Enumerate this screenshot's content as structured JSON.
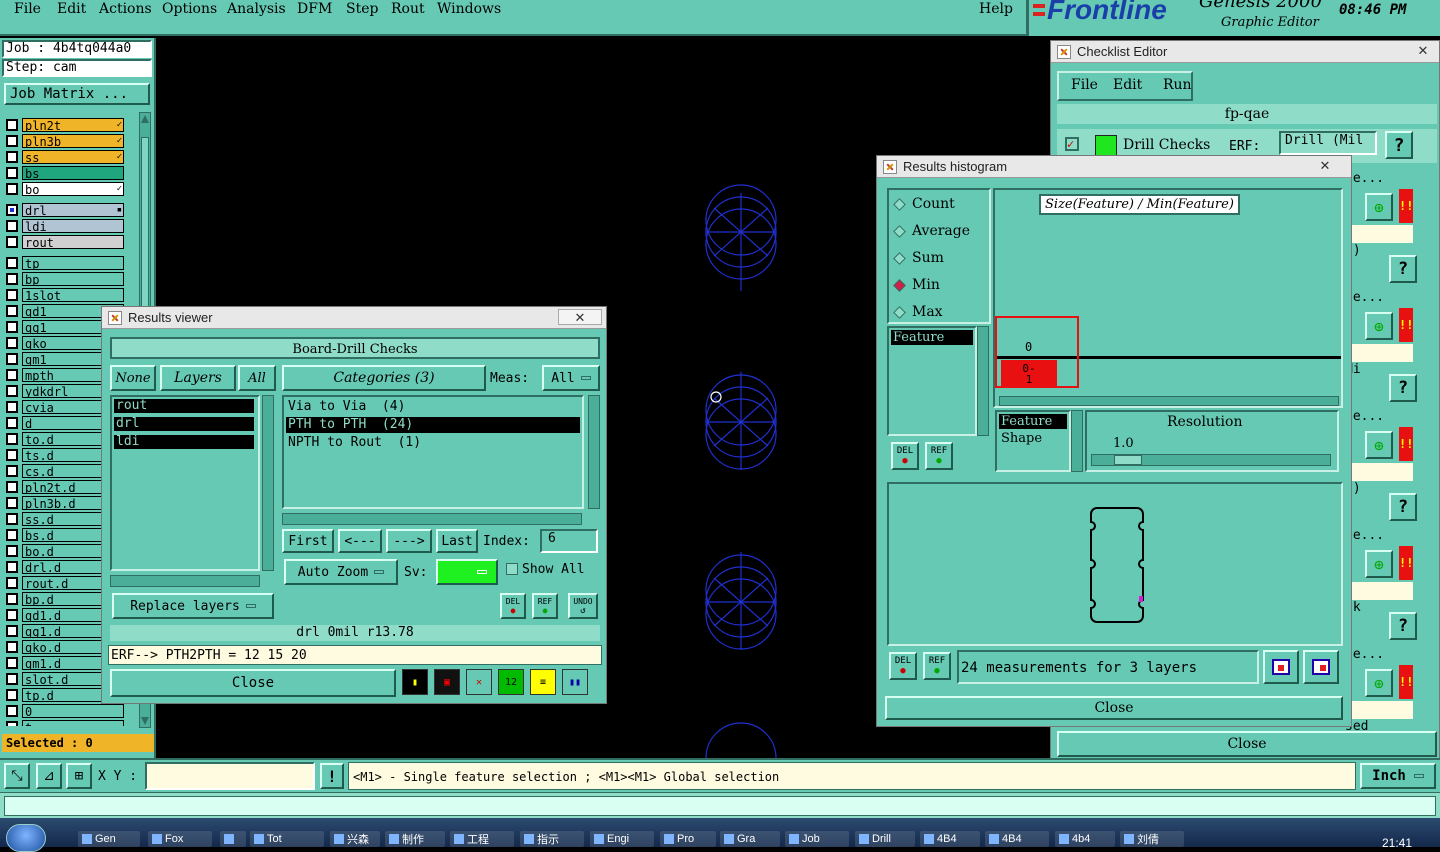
{
  "menubar": {
    "items": [
      "File",
      "Edit",
      "Actions",
      "Options",
      "Analysis",
      "DFM",
      "Step",
      "Rout",
      "Windows"
    ],
    "help": "Help",
    "brand": "Frontline",
    "product": "Genesis 2000",
    "subtitle": "Graphic Editor",
    "clock": "08:46 PM"
  },
  "left_panel": {
    "job": "Job : 4b4tq044a0",
    "step": "Step: cam",
    "job_matrix": "Job Matrix ...",
    "layers_top": [
      {
        "name": "pln2t",
        "color": "#f0b429",
        "mark": "✓"
      },
      {
        "name": "pln3b",
        "color": "#f0b429",
        "mark": "✓"
      },
      {
        "name": "ss",
        "color": "#f0b429",
        "mark": "✓"
      },
      {
        "name": "bs",
        "color": "#1fa67f",
        "mark": ""
      },
      {
        "name": "bo",
        "color": "#ffffff",
        "mark": "✓"
      }
    ],
    "layers_drill": [
      {
        "name": "drl",
        "color": "#b0c4d4",
        "mark": "▪"
      },
      {
        "name": "ldi",
        "color": "#b0c4d4",
        "mark": ""
      },
      {
        "name": "rout",
        "color": "#d0d0d0",
        "mark": ""
      }
    ],
    "layers_misc": [
      "tp",
      "bp",
      "1slot",
      "gd1",
      "gg1",
      "gko",
      "gm1",
      "mpth",
      "ydkdrl",
      "cvia",
      "d",
      "to.d",
      "ts.d",
      "cs.d",
      "pln2t.d",
      "pln3b.d",
      "ss.d",
      "bs.d",
      "bo.d",
      "drl.d",
      "rout.d",
      "bp.d",
      "gd1.d",
      "gg1.d",
      "gko.d",
      "gm1.d",
      "slot.d",
      "tp.d",
      "0",
      "t"
    ],
    "selected": "Selected : 0"
  },
  "statusbar": {
    "xy_label": "X Y :",
    "xy_value": "",
    "warn": "!",
    "message": "<M1> - Single feature selection ; <M1><M1> Global selection",
    "units": "Inch"
  },
  "results_viewer": {
    "title": "Results viewer",
    "close_x": "✕",
    "header": "Board-Drill Checks",
    "none_btn": "None",
    "layers_btn": "Layers",
    "all_btn": "All",
    "categories_btn": "Categories (3)",
    "meas_label": "Meas:",
    "meas_value": "All",
    "layers": [
      "rout",
      "drl",
      "ldi"
    ],
    "categories": [
      "Via to Via  (4)",
      "PTH to PTH  (24)",
      "NPTH to Rout  (1)"
    ],
    "selected_category": 1,
    "first": "First",
    "prev": "<---",
    "next": "--->",
    "last": "Last",
    "index_label": "Index:",
    "index_value": "6",
    "replace_layers": "Replace layers",
    "auto_zoom": "Auto Zoom",
    "sv_label": "Sv:",
    "show_all": "Show All",
    "del": "DEL",
    "ref": "REF",
    "undo": "UNDO",
    "info": "drl 0mil  r13.78",
    "erf_line": "ERF--> PTH2PTH = 12 15 20",
    "close": "Close"
  },
  "histogram": {
    "title": "Results histogram",
    "options": [
      "Count",
      "Average",
      "Sum",
      "Min",
      "Max"
    ],
    "selected_option": 3,
    "heading": "Size(Feature) / Min(Feature)",
    "feature_list": [
      "Feature"
    ],
    "bar_value": "0",
    "bar_label": "0-\n1",
    "group_list": [
      "Feature",
      "Shape"
    ],
    "resolution_label": "Resolution",
    "resolution_value": "1.0",
    "del": "DEL",
    "ref": "REF",
    "measurements": "24 measurements for 3 layers",
    "close": "Close"
  },
  "checklist": {
    "title": "Checklist Editor",
    "menu": [
      "File",
      "Edit",
      "Run"
    ],
    "name": "fp-qae",
    "row_label": "Drill Checks",
    "erf_label": "ERF:",
    "erf_value": "Drill (Mil",
    "partial": [
      "ne...",
      "s)",
      "ne...",
      "Mi",
      "ne...",
      "s)",
      "ne...",
      "sk",
      "ne...",
      "sed"
    ],
    "close": "Close"
  },
  "taskbar": {
    "items": [
      "Gen",
      "Fox",
      "",
      "Tot",
      "兴森",
      "制作",
      "工程",
      "指示",
      "Engi",
      "Pro",
      "Gra",
      "Job",
      "Drill",
      "4B4",
      "4B4",
      "4b4",
      "刘倩"
    ],
    "clock": "21:41"
  }
}
